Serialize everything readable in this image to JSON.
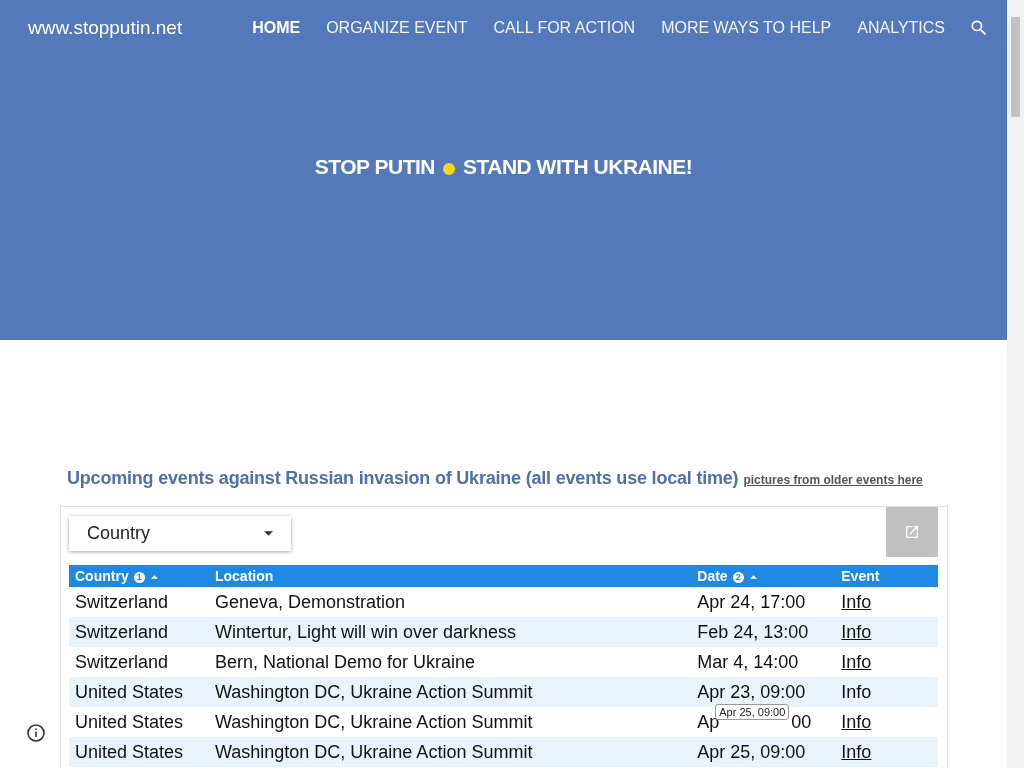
{
  "site_title": "www.stopputin.net",
  "nav": [
    {
      "label": "HOME",
      "selected": true
    },
    {
      "label": "ORGANIZE EVENT",
      "selected": false
    },
    {
      "label": "CALL FOR ACTION",
      "selected": false
    },
    {
      "label": "MORE WAYS TO HELP",
      "selected": false
    },
    {
      "label": "ANALYTICS",
      "selected": false
    }
  ],
  "hero": {
    "left": "STOP PUTIN",
    "right": "STAND WITH UKRAINE!"
  },
  "heading": "Upcoming events against Russian invasion of Ukraine (all events use local time)",
  "heading_link": "pictures from older events here",
  "filter": {
    "label": "Country"
  },
  "table": {
    "columns": [
      {
        "label": "Country",
        "sort_index": "1"
      },
      {
        "label": "Location"
      },
      {
        "label": "Date",
        "sort_index": "2"
      },
      {
        "label": "Event"
      }
    ],
    "rows": [
      {
        "country": "Switzerland",
        "location": "Geneva, Demonstration",
        "date": "Apr 24, 17:00",
        "event": "Info",
        "link": true
      },
      {
        "country": "Switzerland",
        "location": "Wintertur, Light will win over darkness",
        "date": "Feb 24, 13:00",
        "event": "Info",
        "link": true
      },
      {
        "country": "Switzerland",
        "location": "Bern, National Demo for Ukraine",
        "date": "Mar 4, 14:00",
        "event": "Info",
        "link": true
      },
      {
        "country": "United States",
        "location": "Washington DC, Ukraine Action Summit",
        "date": "Apr 23, 09:00",
        "event": "Info",
        "link": false
      },
      {
        "country": "United States",
        "location": "Washington DC, Ukraine Action Summit",
        "date": "Ap",
        "date_end": "00",
        "tooltip": "Apr 25, 09:00",
        "event": "Info",
        "link": true
      },
      {
        "country": "United States",
        "location": "Washington DC, Ukraine Action Summit",
        "date": "Apr 25, 09:00",
        "event": "Info",
        "link": true
      }
    ]
  }
}
